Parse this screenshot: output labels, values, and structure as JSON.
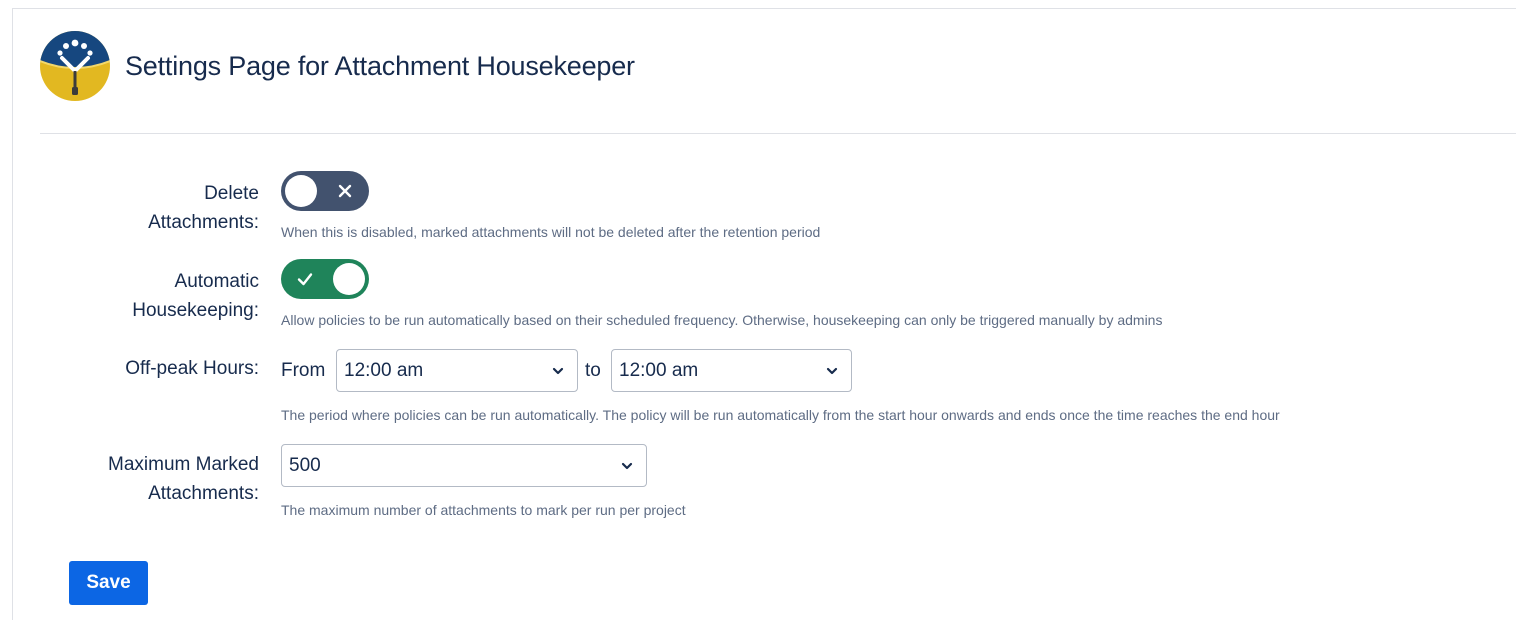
{
  "header": {
    "title": "Settings Page for Attachment Housekeeper",
    "logo_icon": "attachment-housekeeper-logo"
  },
  "settings": {
    "delete_attachments": {
      "label_line1": "Delete",
      "label_line2": "Attachments:",
      "enabled": false,
      "description": "When this is disabled, marked attachments will not be deleted after the retention period"
    },
    "automatic_housekeeping": {
      "label_line1": "Automatic",
      "label_line2": "Housekeeping:",
      "enabled": true,
      "description": "Allow policies to be run automatically based on their scheduled frequency. Otherwise, housekeeping can only be triggered manually by admins"
    },
    "off_peak_hours": {
      "label": "Off-peak Hours:",
      "from_text": "From",
      "from_value": "12:00 am",
      "to_text": "to",
      "to_value": "12:00 am",
      "description": "The period where policies can be run automatically. The policy will be run automatically from the start hour onwards and ends once the time reaches the end hour"
    },
    "maximum_marked_attachments": {
      "label_line1": "Maximum Marked",
      "label_line2": "Attachments:",
      "value": "500",
      "description": "The maximum number of attachments to mark per run per project"
    }
  },
  "actions": {
    "save_label": "Save"
  },
  "colors": {
    "toggle_off": "#42526e",
    "toggle_on": "#1f845a",
    "primary_button": "#0c66e4",
    "text": "#172b4d",
    "muted_text": "#5e6c84"
  }
}
